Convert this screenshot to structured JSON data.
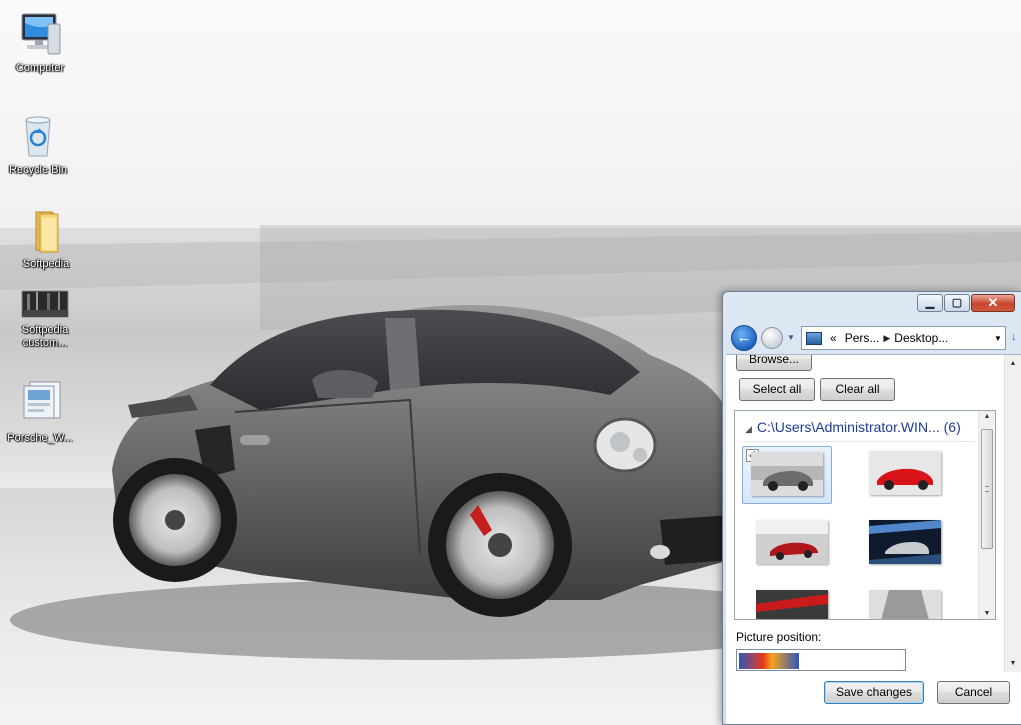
{
  "desktop": {
    "icons": [
      {
        "label": "Computer"
      },
      {
        "label": "Recycle Bin"
      },
      {
        "label": "Softpedia"
      },
      {
        "label": "Softpedia custom..."
      },
      {
        "label": "Porsche_W..."
      }
    ]
  },
  "window": {
    "address": {
      "prefix": "«",
      "segments": [
        "Pers...",
        "Desktop..."
      ]
    },
    "browse_label": "Browse...",
    "select_all_label": "Select all",
    "clear_all_label": "Clear all",
    "gallery": {
      "group_path": "C:\\Users\\Administrator.WIN...",
      "group_count": "(6)",
      "selected_check": "✓"
    },
    "picture_position_label": "Picture position:",
    "save_label": "Save changes",
    "cancel_label": "Cancel"
  },
  "colors": {
    "accent": "#1e3a9b",
    "selection": "#d6e7fb"
  }
}
